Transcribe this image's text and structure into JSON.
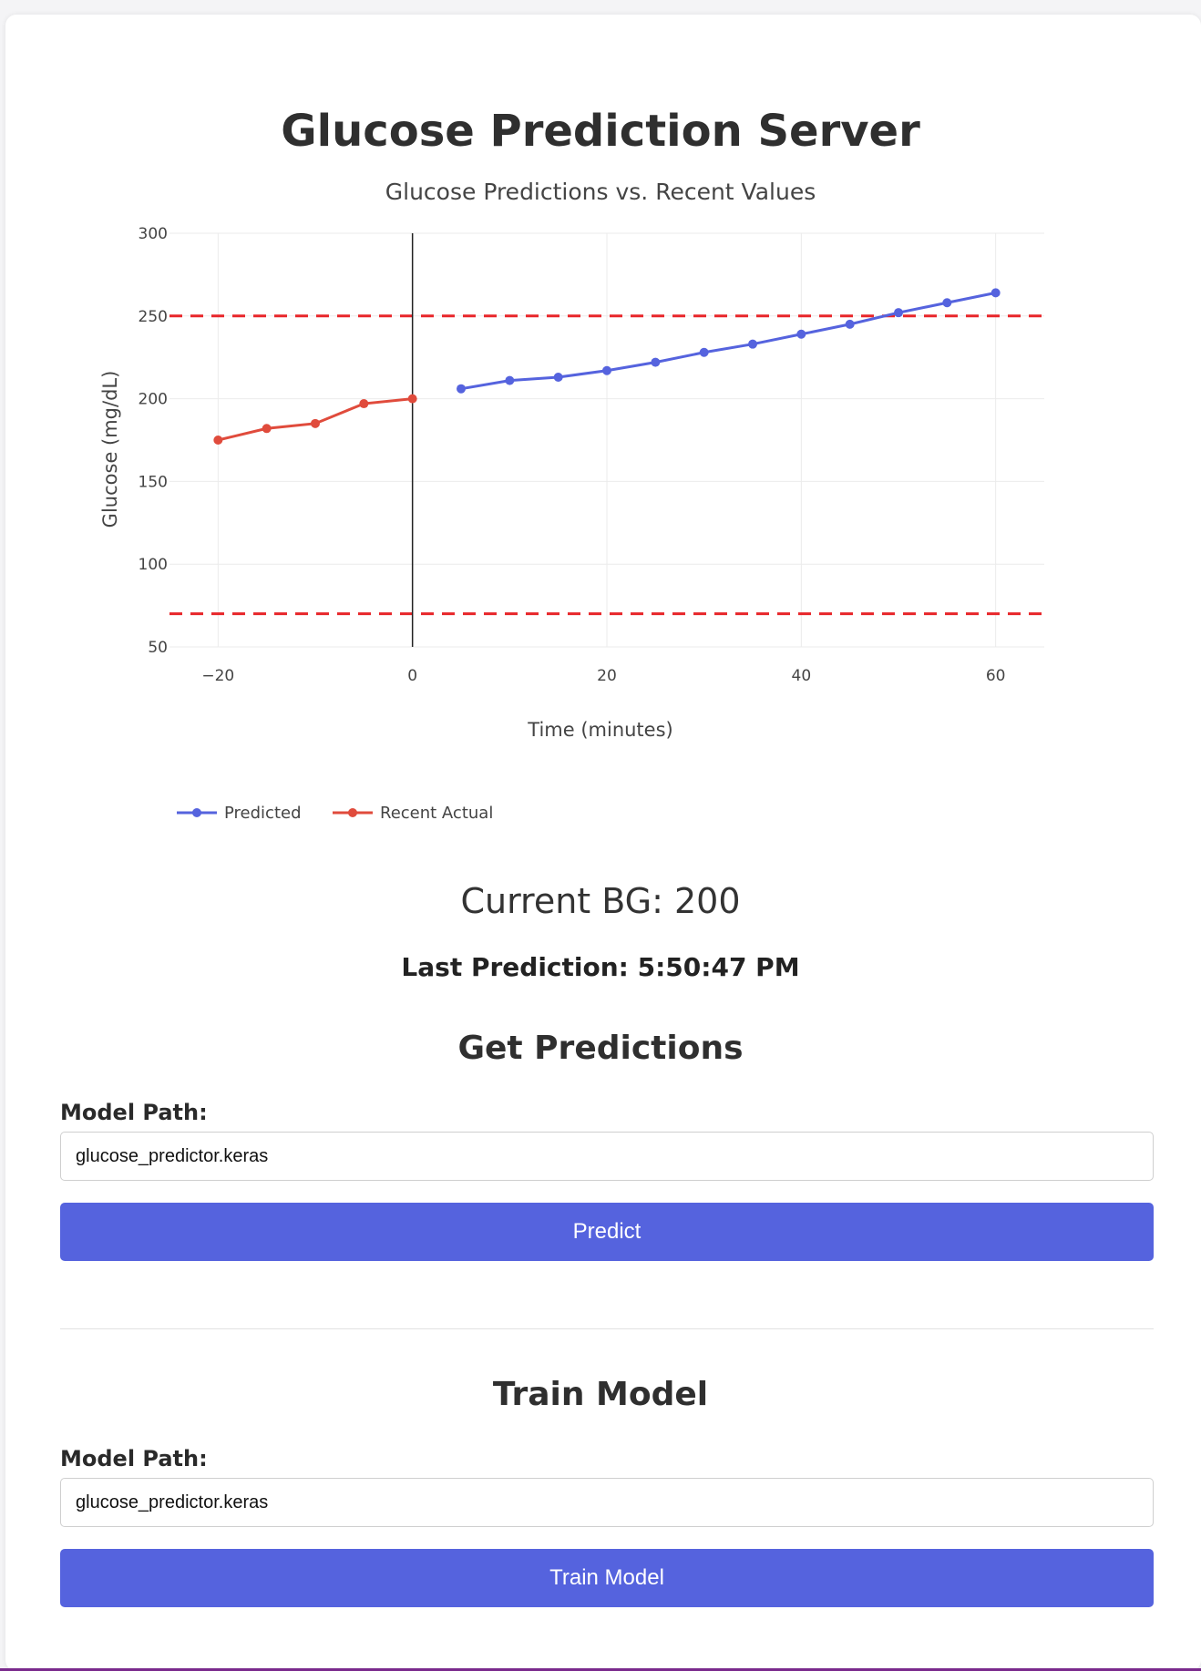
{
  "page": {
    "title": "Glucose Prediction Server"
  },
  "status": {
    "current_bg": "Current BG: 200",
    "last_prediction": "Last Prediction: 5:50:47 PM"
  },
  "predict_section": {
    "title": "Get Predictions",
    "model_path_label": "Model Path:",
    "model_path_value": "glucose_predictor.keras",
    "button_label": "Predict"
  },
  "train_section": {
    "title": "Train Model",
    "model_path_label": "Model Path:",
    "model_path_value": "glucose_predictor.keras",
    "button_label": "Train Model"
  },
  "colors": {
    "predicted": "#5563de",
    "recent_actual": "#e04b3c",
    "threshold": "#e8262a",
    "button": "#5563de"
  },
  "chart_data": {
    "type": "line",
    "title": "Glucose Predictions vs. Recent Values",
    "xlabel": "Time (minutes)",
    "ylabel": "Glucose (mg/dL)",
    "xlim": [
      -25,
      65
    ],
    "ylim": [
      50,
      300
    ],
    "xticks": [
      -20,
      0,
      20,
      40,
      60
    ],
    "xtick_labels": [
      "−20",
      "0",
      "20",
      "40",
      "60"
    ],
    "yticks": [
      50,
      100,
      150,
      200,
      250,
      300
    ],
    "grid": true,
    "legend_position": "bottom-left",
    "series": [
      {
        "name": "Predicted",
        "color": "#5563de",
        "x": [
          5,
          10,
          15,
          20,
          25,
          30,
          35,
          40,
          45,
          50,
          55,
          60
        ],
        "y": [
          206,
          211,
          213,
          217,
          222,
          228,
          233,
          239,
          245,
          252,
          258,
          264
        ]
      },
      {
        "name": "Recent Actual",
        "color": "#e04b3c",
        "x": [
          -20,
          -15,
          -10,
          -5,
          0
        ],
        "y": [
          175,
          182,
          185,
          197,
          200
        ]
      }
    ],
    "hlines": [
      {
        "y": 250,
        "color": "#e8262a",
        "style": "dashed"
      },
      {
        "y": 70,
        "color": "#e8262a",
        "style": "dashed"
      }
    ],
    "vlines": [
      {
        "x": 0,
        "color": "#222222",
        "style": "solid"
      }
    ]
  }
}
